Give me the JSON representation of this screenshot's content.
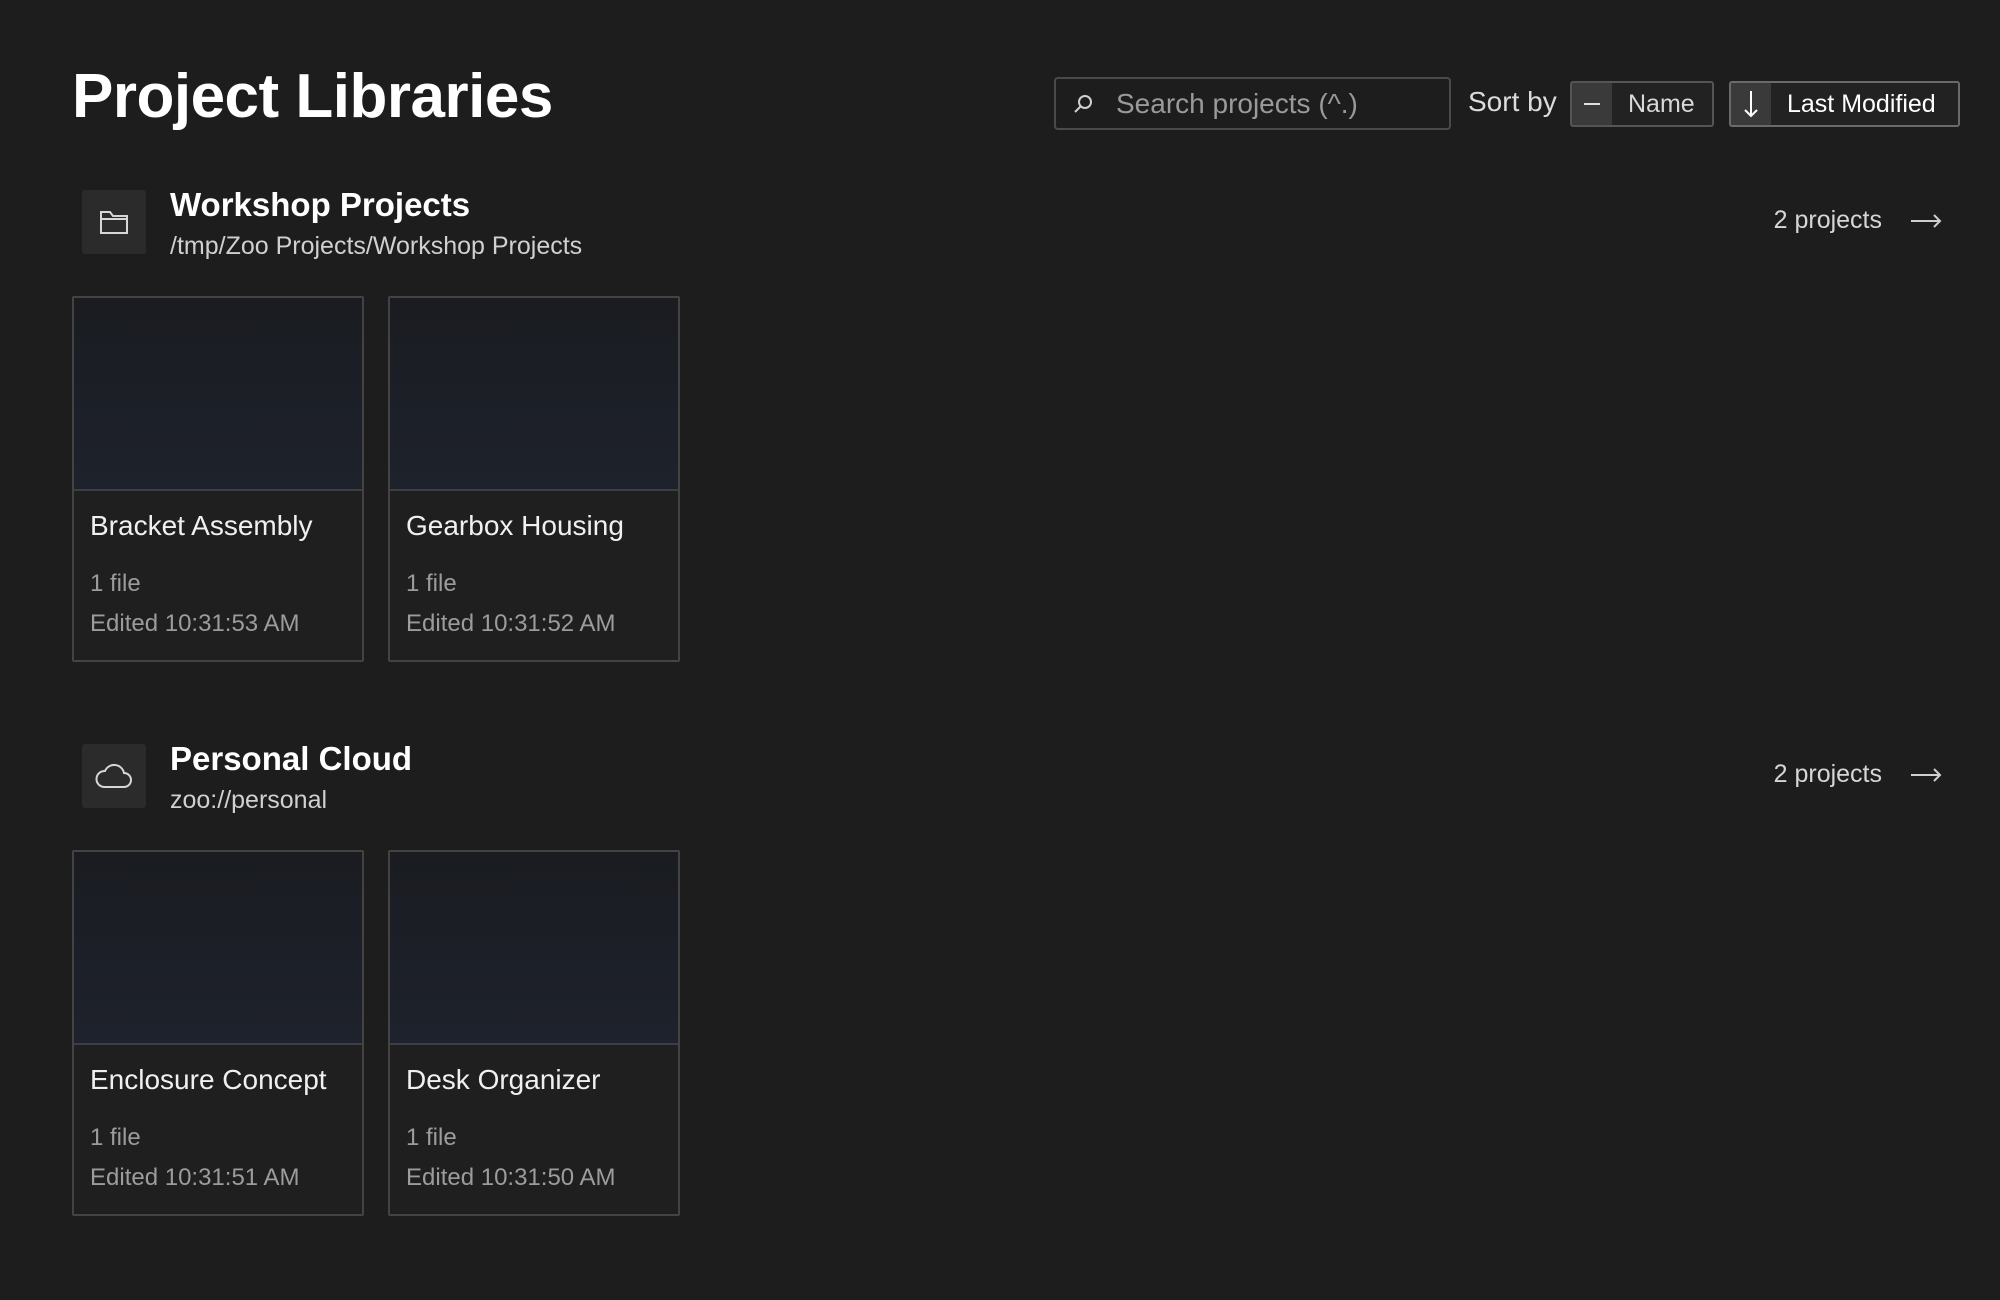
{
  "page": {
    "title": "Project Libraries"
  },
  "search": {
    "placeholder": "Search projects (^.)",
    "value": ""
  },
  "sort": {
    "label": "Sort by",
    "options": [
      {
        "label": "Name",
        "icon": "dash-icon",
        "active": false
      },
      {
        "label": "Last Modified",
        "icon": "arrow-down-icon",
        "active": true
      }
    ]
  },
  "libraries": [
    {
      "title": "Workshop Projects",
      "path": "/tmp/Zoo Projects/Workshop Projects",
      "icon": "folder-icon",
      "count": "2 projects",
      "projects": [
        {
          "name": "Bracket Assembly",
          "files": "1 file",
          "edited": "Edited 10:31:53 AM"
        },
        {
          "name": "Gearbox Housing",
          "files": "1 file",
          "edited": "Edited 10:31:52 AM"
        }
      ]
    },
    {
      "title": "Personal Cloud",
      "path": "zoo://personal",
      "icon": "cloud-icon",
      "count": "2 projects",
      "projects": [
        {
          "name": "Enclosure Concept",
          "files": "1 file",
          "edited": "Edited 10:31:51 AM"
        },
        {
          "name": "Desk Organizer",
          "files": "1 file",
          "edited": "Edited 10:31:50 AM"
        }
      ]
    }
  ]
}
